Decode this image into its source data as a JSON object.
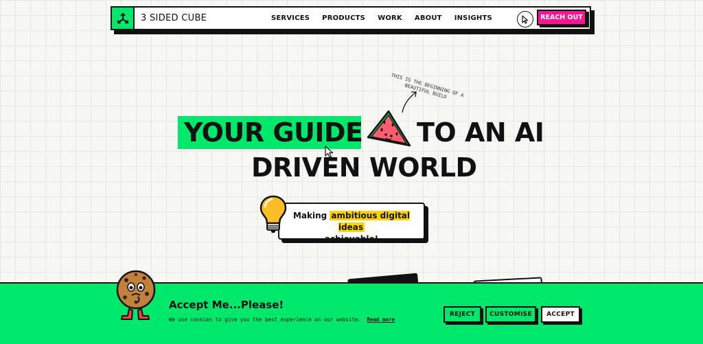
{
  "nav": {
    "brand": "3 SIDED CUBE",
    "items": [
      "SERVICES",
      "PRODUCTS",
      "WORK",
      "ABOUT",
      "INSIGHTS"
    ],
    "cta": "REACH OUT"
  },
  "hero": {
    "annotation": "THIS IS THE BEGINNING OF A BEAUTIFUL BUILD",
    "headline_part1": "YOUR GUIDE",
    "headline_part2": "TO AN AI",
    "headline_line2": "DRIVEN WORLD",
    "tagline_before": "Making",
    "tagline_highlight": "ambitious digital ideas",
    "tagline_after": "achievable!"
  },
  "cookie_banner": {
    "title": "Accept Me...Please!",
    "text": "We use cookies to give you the best experience on our website.",
    "read_more": "Read more",
    "reject": "REJECT",
    "customise": "CUSTOMISE",
    "accept": "ACCEPT"
  },
  "colors": {
    "green": "#00e86c",
    "pink": "#ff1493",
    "yellow": "#ffd400"
  }
}
